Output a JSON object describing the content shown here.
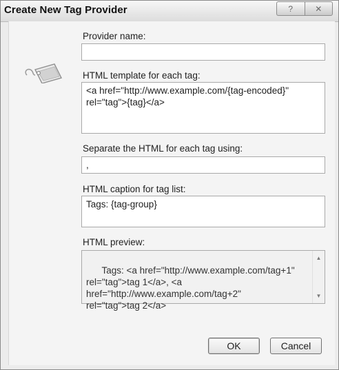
{
  "dialog": {
    "title": "Create New Tag Provider",
    "help_glyph": "?",
    "close_glyph": "✕"
  },
  "fields": {
    "provider_name": {
      "label": "Provider name:",
      "value": ""
    },
    "html_template": {
      "label": "HTML template for each tag:",
      "value": "<a href=\"http://www.example.com/{tag-encoded}\"\nrel=\"tag\">{tag}</a>"
    },
    "separator": {
      "label": "Separate the HTML for each tag using:",
      "value": ","
    },
    "caption": {
      "label": "HTML caption for tag list:",
      "value": "Tags: {tag-group}"
    },
    "preview": {
      "label": "HTML preview:",
      "value": "Tags: <a href=\"http://www.example.com/tag+1\"\nrel=\"tag\">tag 1</a>, <a\nhref=\"http://www.example.com/tag+2\"\nrel=\"tag\">tag 2</a>"
    }
  },
  "buttons": {
    "ok": "OK",
    "cancel": "Cancel"
  },
  "icons": {
    "tag": "tag-icon",
    "help": "help-icon",
    "close": "close-icon"
  }
}
